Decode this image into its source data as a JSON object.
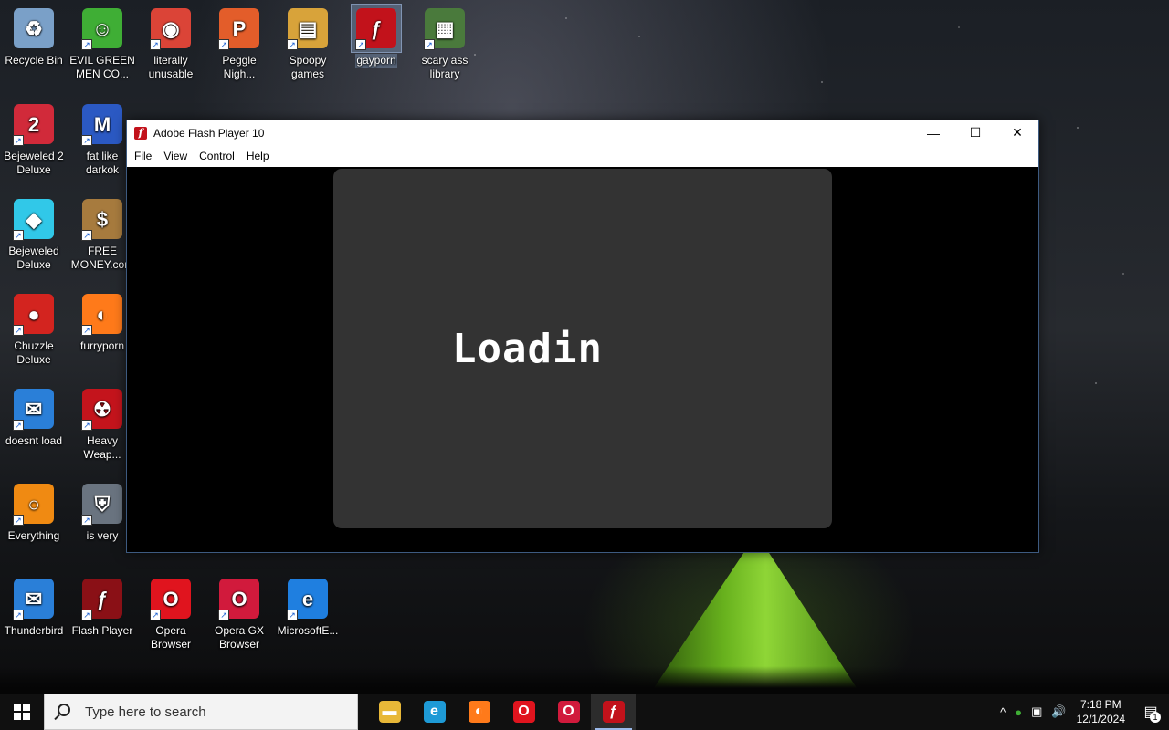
{
  "desktop": {
    "icons": [
      {
        "label": "Recycle Bin",
        "icon": "recycle-bin-icon",
        "color": "#7aa0c8"
      },
      {
        "label": "EVIL GREEN MEN CO...",
        "icon": "messenger-men-icon",
        "color": "#3fae35"
      },
      {
        "label": "literally unusable",
        "icon": "chrome-icon",
        "color": "#db4437"
      },
      {
        "label": "Peggle Nigh...",
        "icon": "peggle-icon",
        "color": "#e35d2a"
      },
      {
        "label": "Spoopy games",
        "icon": "folder-icon",
        "color": "#d8a33a"
      },
      {
        "label": "gayporn",
        "icon": "flash-icon",
        "color": "#c2121b"
      },
      {
        "label": "scary ass library",
        "icon": "library-icon",
        "color": "#4a7a3c"
      },
      {
        "label": "Bejeweled 2 Deluxe",
        "icon": "bejeweled2-icon",
        "color": "#d12a3a"
      },
      {
        "label": "fat like darkok",
        "icon": "mpl-icon",
        "color": "#2b59c3"
      },
      {
        "label": "Bejeweled Deluxe",
        "icon": "diamond-icon",
        "color": "#31c8e8"
      },
      {
        "label": "FREE MONEY.com",
        "icon": "money-bag-icon",
        "color": "#a77b3e"
      },
      {
        "label": "Chuzzle Deluxe",
        "icon": "chuzzle-icon",
        "color": "#d3241f"
      },
      {
        "label": "furryporn",
        "icon": "firefox-icon",
        "color": "#ff7a1a"
      },
      {
        "label": "doesnt load",
        "icon": "thunderbird-icon",
        "color": "#2a7fd8"
      },
      {
        "label": "Heavy Weap...",
        "icon": "radiation-icon",
        "color": "#c4141c"
      },
      {
        "label": "Everything",
        "icon": "everything-search-icon",
        "color": "#f08a12"
      },
      {
        "label": "is very",
        "icon": "shield-mpl-icon",
        "color": "#6a7480"
      },
      {
        "label": "Thunderbird",
        "icon": "thunderbird-icon",
        "color": "#2a7fd8"
      },
      {
        "label": "Flash Player",
        "icon": "flash-icon",
        "color": "#8a1016"
      },
      {
        "label": "Opera Browser",
        "icon": "opera-icon",
        "color": "#e0141e"
      },
      {
        "label": "Opera GX Browser",
        "icon": "opera-gx-icon",
        "color": "#d11a3c"
      },
      {
        "label": "MicrosoftE...",
        "icon": "edge-legacy-icon",
        "color": "#1f7fe0"
      }
    ]
  },
  "window": {
    "title": "Adobe Flash Player 10",
    "menu": [
      "File",
      "View",
      "Control",
      "Help"
    ],
    "controls": {
      "minimize": "—",
      "maximize": "☐",
      "close": "✕"
    },
    "stage_text": "Loadin"
  },
  "taskbar": {
    "search_placeholder": "Type here to search",
    "apps": [
      {
        "name": "file-explorer-icon",
        "color": "#e8b838",
        "active": false
      },
      {
        "name": "edge-icon",
        "color": "#1e9ad6",
        "active": false
      },
      {
        "name": "firefox-icon",
        "color": "#ff7a1a",
        "active": false
      },
      {
        "name": "opera-icon",
        "color": "#e0141e",
        "active": false
      },
      {
        "name": "opera-gx-icon",
        "color": "#d11a3c",
        "active": false
      },
      {
        "name": "flash-player-icon",
        "color": "#c2121b",
        "active": true
      }
    ],
    "tray": {
      "chevron": "^",
      "time": "7:18 PM",
      "date": "12/1/2024",
      "notification_count": "1"
    }
  }
}
